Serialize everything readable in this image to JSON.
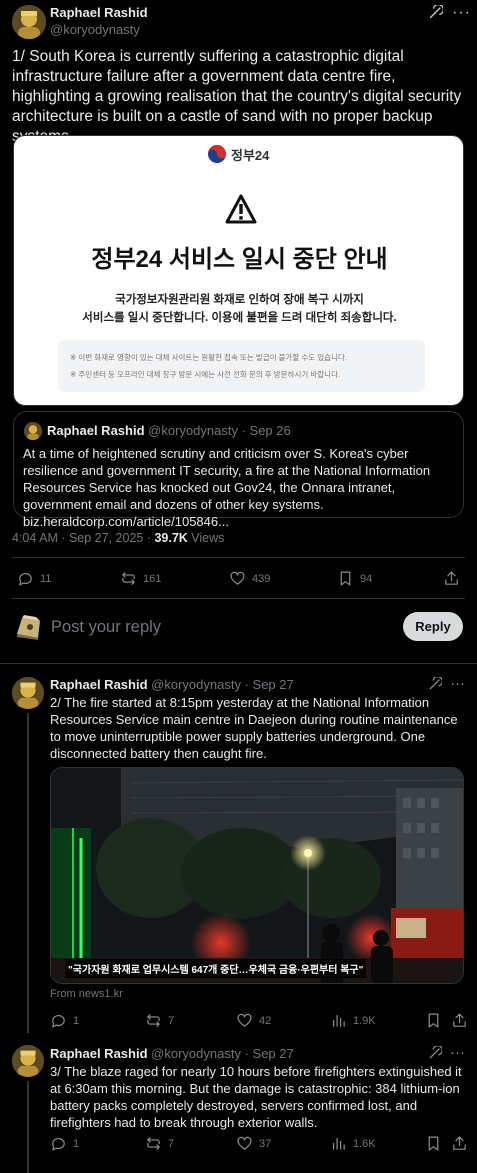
{
  "main_tweet": {
    "author_name": "Raphael Rashid",
    "author_handle": "@koryodynasty",
    "text": "1/ South Korea is currently suffering a catastrophic digital infrastructure failure after a government data centre fire, highlighting a growing realisation that the country's digital security architecture is built on a castle of sand with no proper backup systems.",
    "notice_image": {
      "logo_text": "정부24",
      "title": "정부24 서비스 일시 중단 안내",
      "body_line1": "국가정보자원관리원 화재로 인하여 장애 복구 시까지",
      "body_line2": "서비스를 일시 중단합니다. 이용에 불편을 드려 대단히 죄송합니다.",
      "note1": "※ 이번 화재로 영향이 있는 대체 사이트는 원활한 접속 또는 발급이 불가할 수도 있습니다.",
      "note2": "※ 주민센터 등 오프라인 대체 창구 방문 시에는 사전 전화 문의 후 방문하시기 바랍니다."
    },
    "quote": {
      "author_name": "Raphael Rashid",
      "author_handle": "@koryodynasty",
      "date": "· Sep 26",
      "text": "At a time of heightened scrutiny and criticism over S. Korea's cyber resilience and government IT security, a fire at the National Information Resources Service has knocked out Gov24, the Onnara intranet, government email and dozens of other key systems. biz.heraldcorp.com/article/105846..."
    },
    "timestamp": "4:04 AM · Sep 27, 2025 · ",
    "views_count": "39.7K",
    "views_label": " Views",
    "stats": {
      "replies": "11",
      "reposts": "161",
      "likes": "439",
      "bookmarks": "94"
    }
  },
  "compose": {
    "placeholder": "Post your reply",
    "button": "Reply"
  },
  "replies": [
    {
      "author_name": "Raphael Rashid",
      "author_handle": "@koryodynasty",
      "date": "· Sep 27",
      "text": "2/ The fire started at 8:15pm yesterday at the National Information Resources Service main centre in Daejeon during routine maintenance to move uninterruptible power supply batteries underground. One disconnected battery then caught fire.",
      "image_caption": "\"국가자원 화재로 업무시스템 647개 중단…우체국 금융·우편부터 복구\"",
      "source": "From news1.kr",
      "stats": {
        "replies": "1",
        "reposts": "7",
        "likes": "42",
        "views": "1.9K"
      }
    },
    {
      "author_name": "Raphael Rashid",
      "author_handle": "@koryodynasty",
      "date": "· Sep 27",
      "text": "3/ The blaze raged for nearly 10 hours before firefighters extinguished it at 6:30am this morning. But the damage is catastrophic: 384 lithium-ion battery packs completely destroyed, servers confirmed lost, and firefighters had to break through exterior walls.",
      "stats": {
        "replies": "1",
        "reposts": "7",
        "likes": "37",
        "views": "1.6K"
      }
    }
  ],
  "colors": {
    "background": "#000000",
    "text": "#e7e9ea",
    "muted": "#71767b",
    "border": "#2f3336",
    "reply_button": "#d7dbdc"
  }
}
